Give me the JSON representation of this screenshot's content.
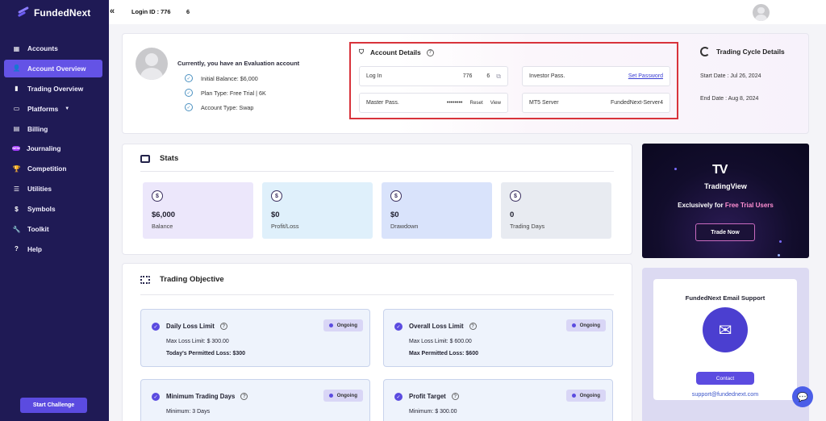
{
  "brand": {
    "name": "FundedNext"
  },
  "sidebar": {
    "items": [
      {
        "label": "Accounts",
        "icon": "grid-icon"
      },
      {
        "label": "Account Overview",
        "icon": "user-icon"
      },
      {
        "label": "Trading Overview",
        "icon": "bar-chart-icon"
      },
      {
        "label": "Platforms",
        "icon": "monitor-icon"
      },
      {
        "label": "Billing",
        "icon": "card-icon"
      },
      {
        "label": "Journaling",
        "icon": "new-badge-icon",
        "badge": "NEW"
      },
      {
        "label": "Competition",
        "icon": "trophy-icon"
      },
      {
        "label": "Utilities",
        "icon": "list-icon"
      },
      {
        "label": "Symbols",
        "icon": "dollar-icon"
      },
      {
        "label": "Toolkit",
        "icon": "wrench-icon"
      },
      {
        "label": "Help",
        "icon": "question-icon"
      }
    ],
    "start_challenge": "Start Challenge"
  },
  "topbar": {
    "collapse_icon": "«",
    "login_label": "Login ID : 776",
    "login_suffix": "6"
  },
  "account": {
    "eval_text": "Currently, you have an Evaluation account",
    "checks": [
      "Initial Balance: $6,000",
      "Plan Type: Free Trial | 6K",
      "Account Type: Swap"
    ],
    "details_title": "Account Details",
    "login_label": "Log In",
    "login_val_a": "776",
    "login_val_b": "6",
    "master_label": "Master Pass.",
    "master_val": "••••••••",
    "reset": "Reset",
    "view": "View",
    "investor_label": "Investor Pass.",
    "set_password": "Set Password",
    "mt5_label": "MT5 Server",
    "mt5_val": "FundedNext-Server4",
    "cycle_title": "Trading Cycle Details",
    "start_date": "Start Date : Jul 26, 2024",
    "end_date": "End Date : Aug 8, 2024"
  },
  "stats": {
    "title": "Stats",
    "items": [
      {
        "value": "$6,000",
        "label": "Balance",
        "color": "#ece7fb"
      },
      {
        "value": "$0",
        "label": "Profit/Loss",
        "color": "#dff0fb"
      },
      {
        "value": "$0",
        "label": "Drawdown",
        "color": "#d9e3fb"
      },
      {
        "value": "0",
        "label": "Trading Days",
        "color": "#e8ebf1"
      }
    ]
  },
  "tradingview": {
    "logo": "TV",
    "name": "TradingView",
    "tag_prefix": "Exclusively for ",
    "tag_highlight": "Free Trial Users",
    "button": "Trade Now"
  },
  "objectives": {
    "title": "Trading Objective",
    "items": [
      {
        "title": "Daily Loss Limit",
        "status": "Ongoing",
        "line1": "Max Loss Limit: $ 300.00",
        "line2": "Today's Permitted Loss: $300"
      },
      {
        "title": "Overall Loss Limit",
        "status": "Ongoing",
        "line1": "Max Loss Limit: $ 600.00",
        "line2": "Max Permitted Loss: $600"
      },
      {
        "title": "Minimum Trading Days",
        "status": "Ongoing",
        "line1": "Minimum: 3 Days",
        "line2": ""
      },
      {
        "title": "Profit Target",
        "status": "Ongoing",
        "line1": "Minimum: $ 300.00",
        "line2": ""
      }
    ]
  },
  "support": {
    "title": "FundedNext Email Support",
    "button": "Contact",
    "email": "support@fundednext.com"
  }
}
